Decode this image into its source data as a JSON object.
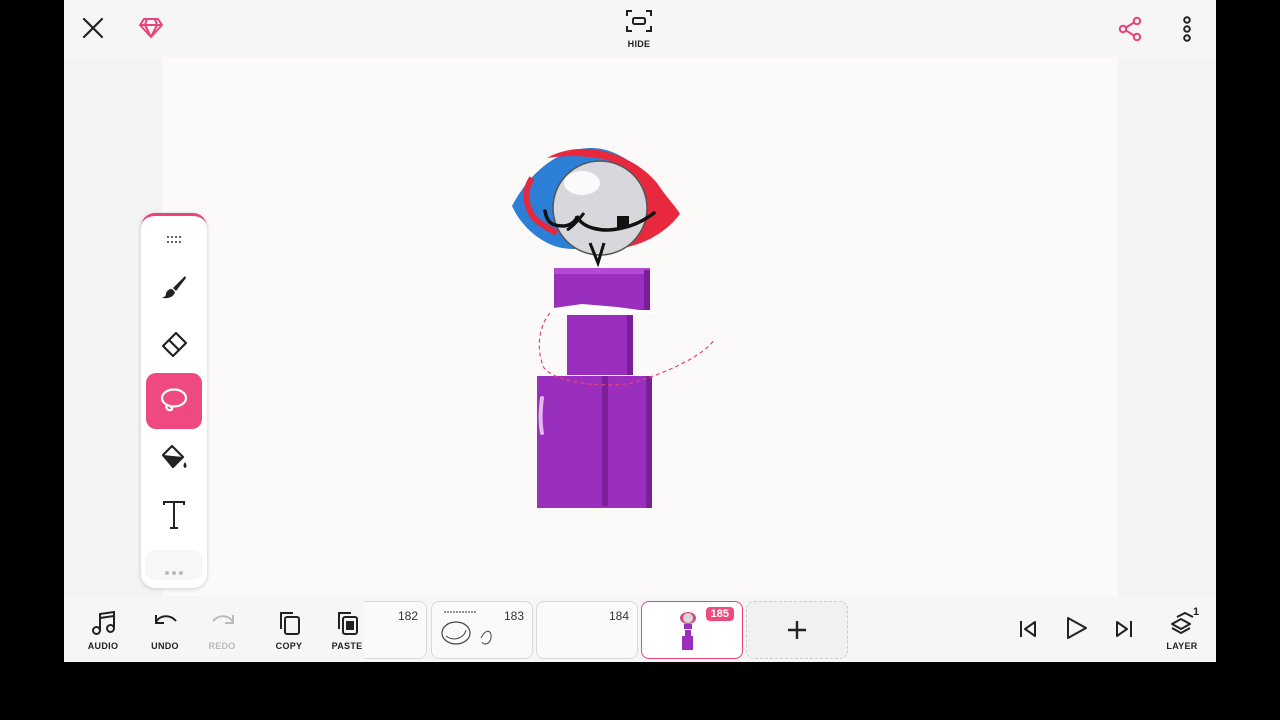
{
  "topbar": {
    "close_icon": "close-icon",
    "premium_icon": "diamond-icon",
    "hide_label": "HIDE",
    "share_icon": "share-icon",
    "more_icon": "more-vertical-icon",
    "accent_color": "#e8437a"
  },
  "toolbox": {
    "tools": [
      {
        "name": "brush",
        "icon": "brush-icon"
      },
      {
        "name": "eraser",
        "icon": "eraser-icon"
      },
      {
        "name": "lasso",
        "icon": "lasso-icon",
        "active": true
      },
      {
        "name": "fill",
        "icon": "paint-bucket-icon"
      },
      {
        "name": "text",
        "icon": "text-icon"
      }
    ]
  },
  "bottombar": {
    "audio_label": "AUDIO",
    "undo_label": "UNDO",
    "redo_label": "REDO",
    "copy_label": "COPY",
    "paste_label": "PASTE",
    "layer_label": "LAYER",
    "layer_count": "1",
    "frames": [
      {
        "number": "182"
      },
      {
        "number": "183"
      },
      {
        "number": "184"
      },
      {
        "number": "185",
        "active": true
      }
    ]
  }
}
